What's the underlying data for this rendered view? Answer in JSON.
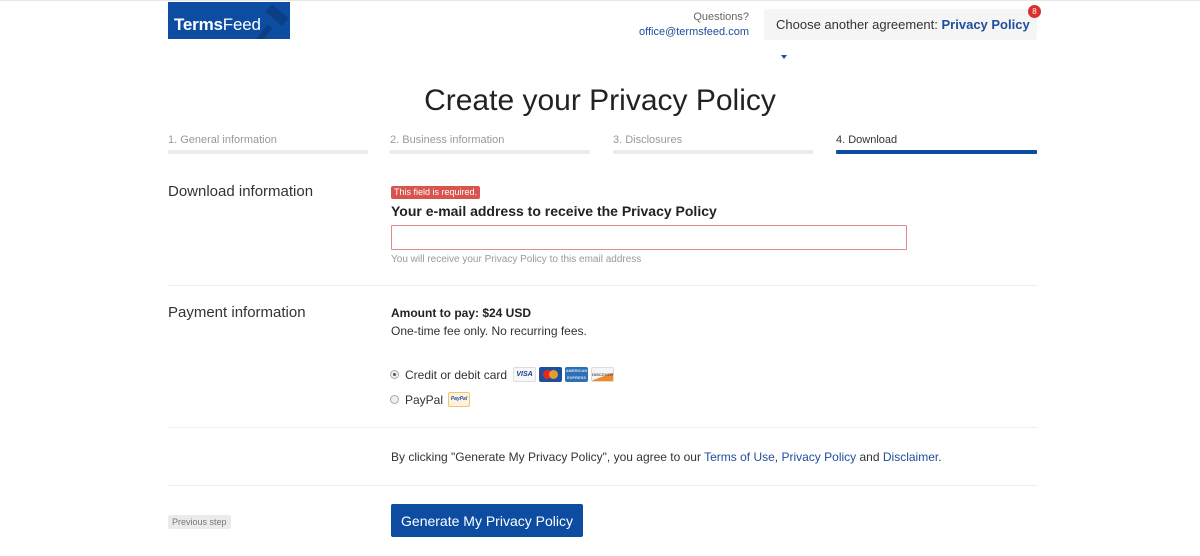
{
  "header": {
    "logo_bold": "Terms",
    "logo_light": "Feed",
    "questions_label": "Questions?",
    "contact_email": "office@termsfeed.com",
    "agreement_prefix": "Choose another agreement:",
    "agreement_selected": "Privacy Policy",
    "notification_count": "8"
  },
  "page_title": "Create your Privacy Policy",
  "steps": [
    {
      "label": "1. General information",
      "state": "complete"
    },
    {
      "label": "2. Business information",
      "state": "complete"
    },
    {
      "label": "3. Disclosures",
      "state": "complete"
    },
    {
      "label": "4. Download",
      "state": "active"
    }
  ],
  "download_section": {
    "heading": "Download information",
    "error_message": "This field is required.",
    "email_label": "Your e-mail address to receive the Privacy Policy",
    "email_value": "",
    "email_help": "You will receive your Privacy Policy to this email address"
  },
  "payment_section": {
    "heading": "Payment information",
    "amount": "Amount to pay: $24 USD",
    "fee_note": "One-time fee only. No recurring fees.",
    "options": [
      {
        "label": "Credit or debit card",
        "selected": true,
        "cards": [
          "VISA",
          "MasterCard",
          "American Express",
          "DISCOVER"
        ]
      },
      {
        "label": "PayPal",
        "selected": false,
        "badge": "PayPal"
      }
    ]
  },
  "terms": {
    "prefix": "By clicking \"Generate My Privacy Policy\", you agree to our ",
    "link1": "Terms of Use",
    "sep": ", ",
    "link2": "Privacy Policy",
    "and": " and ",
    "link3": "Disclaimer",
    "suffix": "."
  },
  "actions": {
    "previous_label": "Previous step",
    "generate_label": "Generate My Privacy Policy"
  },
  "colors": {
    "brand": "#0c4da2",
    "link": "#1e4e9b",
    "error": "#d9534f"
  }
}
